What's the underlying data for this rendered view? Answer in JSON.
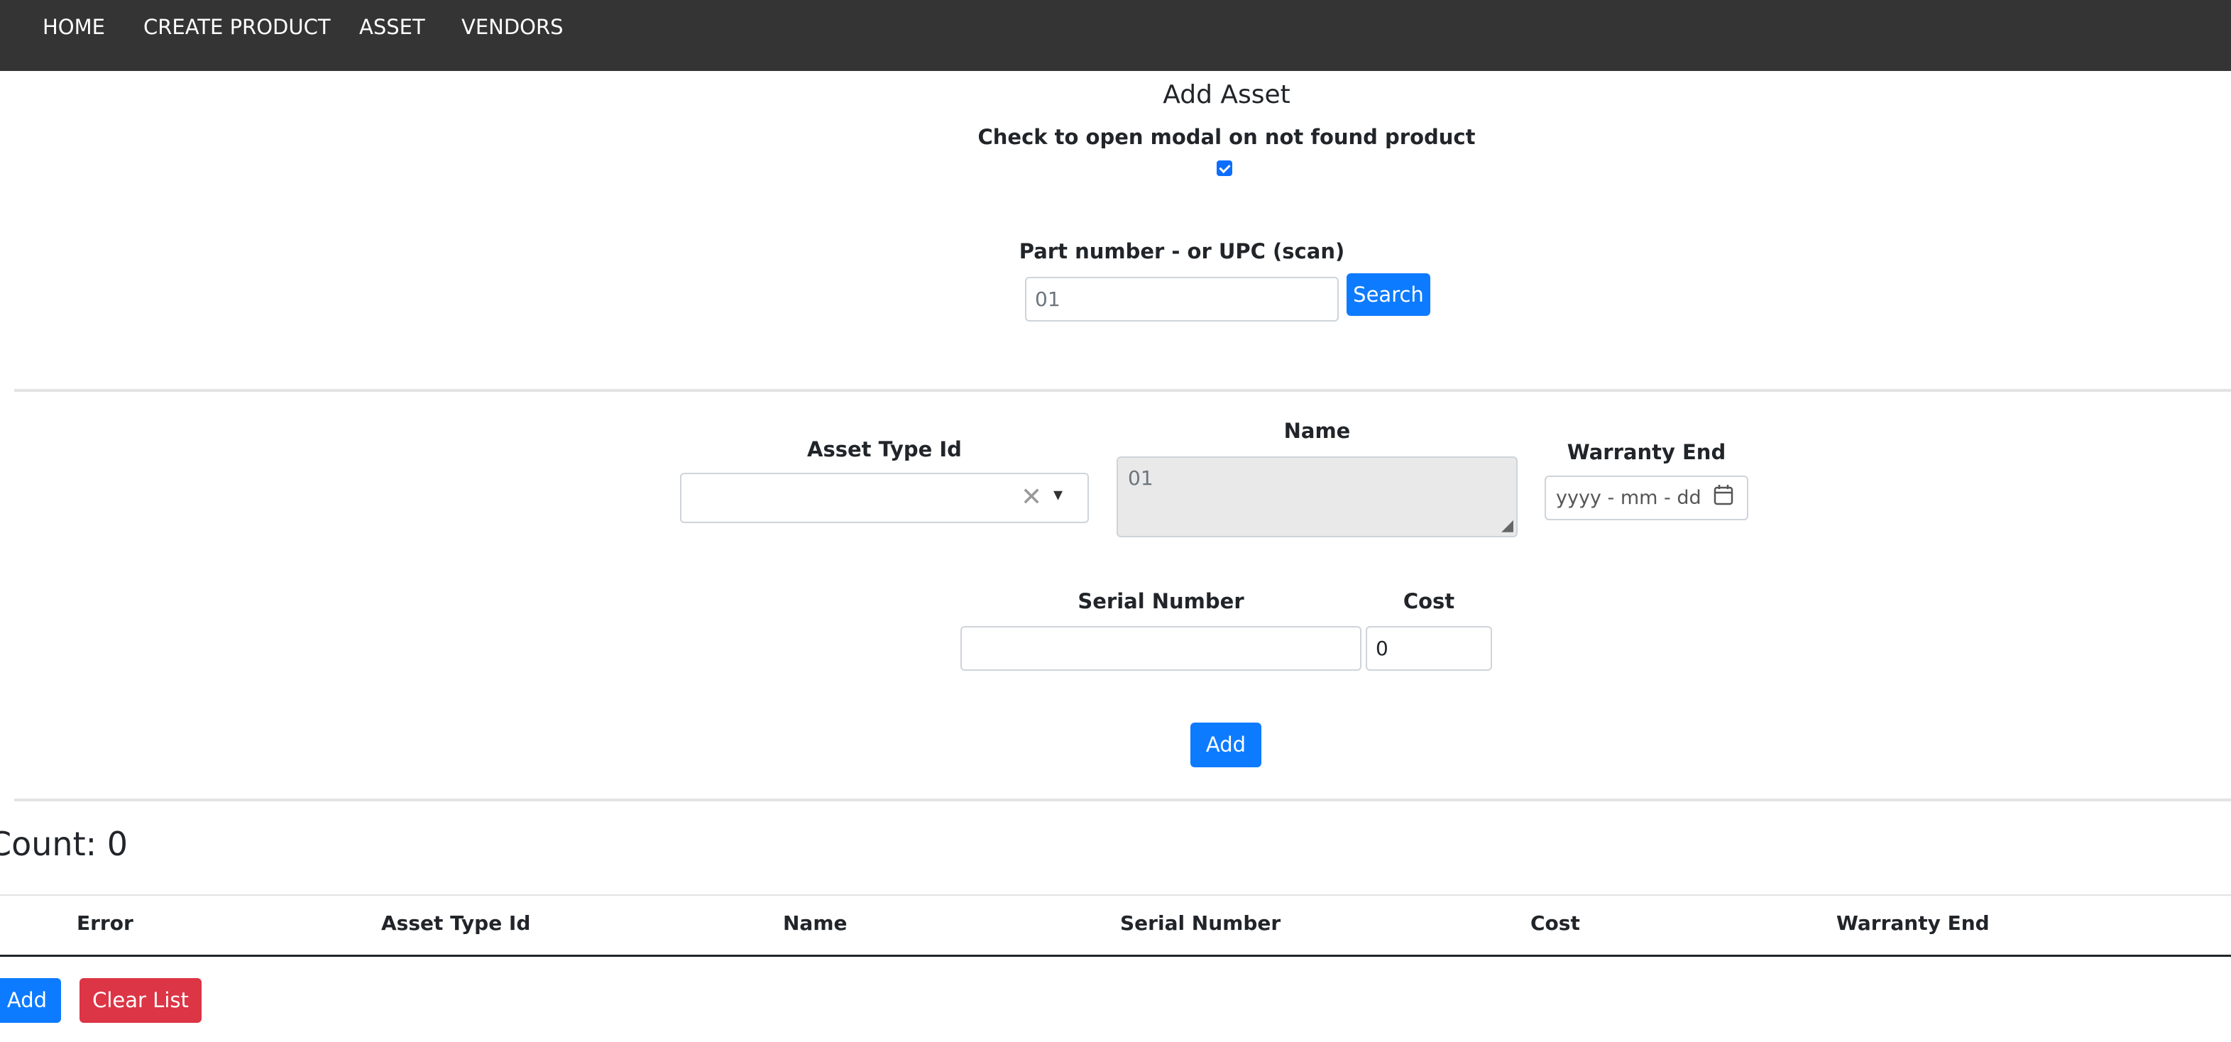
{
  "nav": {
    "items": [
      "HOME",
      "CREATE PRODUCT",
      "ASSET",
      "VENDORS"
    ]
  },
  "page": {
    "title": "Add Asset",
    "modal_check_label": "Check to open modal on not found product",
    "modal_check_checked": true
  },
  "search": {
    "label": "Part number - or UPC (scan)",
    "value": "01",
    "button": "Search"
  },
  "form": {
    "asset_type_label": "Asset Type Id",
    "asset_type_value": "",
    "name_label": "Name",
    "name_value": "01",
    "warranty_label": "Warranty End",
    "warranty_placeholder": "yyyy - mm - dd",
    "serial_label": "Serial Number",
    "serial_value": "",
    "cost_label": "Cost",
    "cost_value": "0",
    "add_button": "Add"
  },
  "list": {
    "count_text": "Count: 0",
    "columns": [
      "Error",
      "Asset Type Id",
      "Name",
      "Serial Number",
      "Cost",
      "Warranty End"
    ],
    "rows": [],
    "add_button": "Add",
    "clear_button": "Clear List"
  },
  "colors": {
    "navbar": "#343434",
    "primary": "#0d7bff",
    "danger": "#dc3545",
    "readonly_bg": "#e9e9e9"
  }
}
